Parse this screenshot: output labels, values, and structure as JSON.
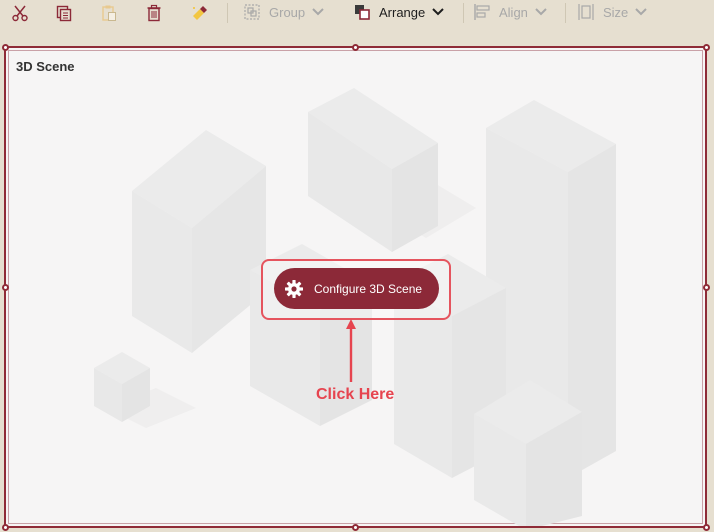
{
  "toolbar": {
    "icons": [
      "cut-icon",
      "copy-icon",
      "paste-icon",
      "delete-icon",
      "clear-format-icon"
    ],
    "group_label": "Group",
    "arrange_label": "Arrange",
    "align_label": "Align",
    "size_label": "Size"
  },
  "panel": {
    "title": "3D Scene",
    "configure_label": "Configure 3D Scene",
    "hint_label": "Click Here"
  },
  "colors": {
    "accent": "#8c2938",
    "selection_border": "#8f2b37",
    "callout": "#e5545e",
    "hint": "#e6444f",
    "toolbar_bg": "#e6dfd0"
  }
}
